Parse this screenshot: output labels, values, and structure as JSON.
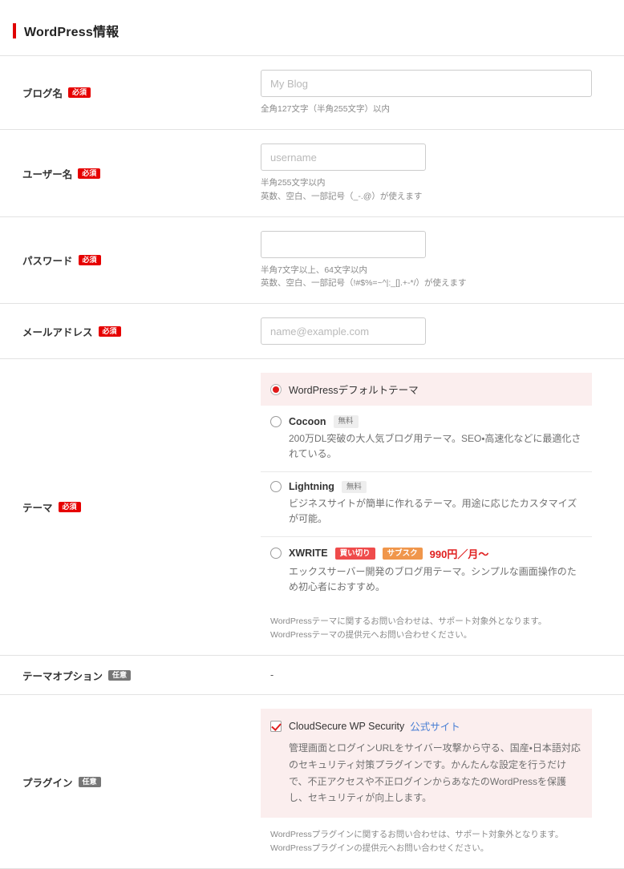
{
  "section": {
    "title": "WordPress情報",
    "accent_color": "#e00000"
  },
  "badges": {
    "required": "必須",
    "optional": "任意"
  },
  "fields": {
    "blog_name": {
      "label": "ブログ名",
      "placeholder": "My Blog",
      "value": "",
      "hint": "全角127文字（半角255文字）以内"
    },
    "username": {
      "label": "ユーザー名",
      "placeholder": "username",
      "value": "",
      "hint_line1": "半角255文字以内",
      "hint_line2": "英数、空白、一部記号（_-.@）が使えます"
    },
    "password": {
      "label": "パスワード",
      "placeholder": "",
      "value": "",
      "hint_line1": "半角7文字以上、64文字以内",
      "hint_line2": "英数、空白、一部記号（!#$%=~^|:_[].+-*/）が使えます"
    },
    "email": {
      "label": "メールアドレス",
      "placeholder": "name@example.com",
      "value": ""
    },
    "theme": {
      "label": "テーマ",
      "note_line1": "WordPressテーマに関するお問い合わせは、サポート対象外となります。",
      "note_line2": "WordPressテーマの提供元へお問い合わせください。",
      "options": [
        {
          "name": "WordPressデフォルトテーマ",
          "selected": true,
          "desc": "",
          "tags": []
        },
        {
          "name": "Cocoon",
          "selected": false,
          "desc": "200万DL突破の大人気ブログ用テーマ。SEO・高速化などに最適化されている。",
          "tags": [
            {
              "text": "無料",
              "style": "free"
            }
          ]
        },
        {
          "name": "Lightning",
          "selected": false,
          "desc": "ビジネスサイトが簡単に作れるテーマ。用途に応じたカスタマイズが可能。",
          "tags": [
            {
              "text": "無料",
              "style": "free"
            }
          ]
        },
        {
          "name": "XWRITE",
          "selected": false,
          "desc": "エックスサーバー開発のブログ用テーマ。シンプルな画面操作のため初心者におすすめ。",
          "tags": [
            {
              "text": "買い切り",
              "style": "onetime"
            },
            {
              "text": "サブスク",
              "style": "subsc"
            }
          ],
          "price": "990円／月〜"
        }
      ]
    },
    "theme_option": {
      "label": "テーマオプション",
      "value": "-"
    },
    "plugin": {
      "label": "プラグイン",
      "checked": true,
      "name": "CloudSecure WP Security",
      "link_text": "公式サイト",
      "desc": "管理画面とログインURLをサイバー攻撃から守る、国産・日本語対応のセキュリティ対策プラグインです。かんたんな設定を行うだけで、不正アクセスや不正ログインからあなたのWordPressを保護し、セキュリティが向上します。",
      "note_line1": "WordPressプラグインに関するお問い合わせは、サポート対象外となります。",
      "note_line2": "WordPressプラグインの提供元へお問い合わせください。"
    }
  }
}
